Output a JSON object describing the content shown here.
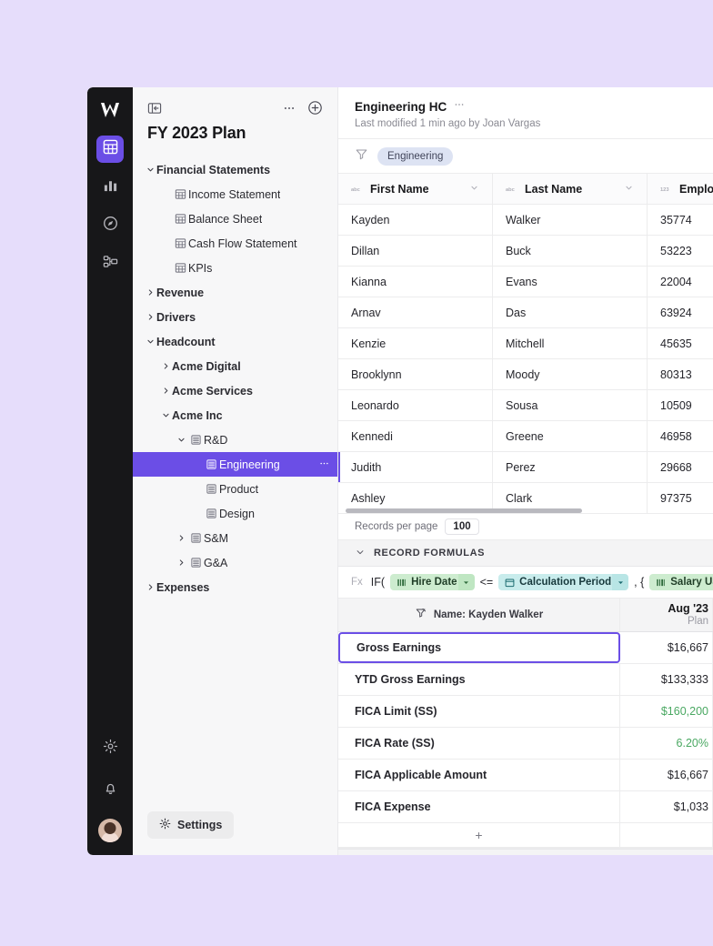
{
  "theme": {
    "canvas_bg": "#e6ddfb",
    "accent": "#6b4ee6",
    "rail_bg": "#171719",
    "sidebar_bg": "#f7f7f8",
    "pill_bg": "#dde3f3",
    "token_green": "#cdeccf",
    "token_blue": "#c8ecec",
    "value_green": "#4aa862"
  },
  "rail": {
    "logo_name": "workspace-logo",
    "items": [
      {
        "name": "grid-icon",
        "active": true
      },
      {
        "name": "chart-icon",
        "active": false
      },
      {
        "name": "compass-icon",
        "active": false
      },
      {
        "name": "model-map-icon",
        "active": false
      }
    ],
    "bottom": [
      {
        "name": "gear-icon"
      },
      {
        "name": "bell-icon"
      },
      {
        "name": "avatar"
      }
    ]
  },
  "sidebar": {
    "collapse_icon": "panel-collapse-icon",
    "more_icon": "ellipsis-icon",
    "add_icon": "plus-circle-icon",
    "title": "FY 2023 Plan",
    "settings_label": "Settings",
    "tree": [
      {
        "label": "Financial Statements",
        "depth": 0,
        "expanded": true,
        "bold": true,
        "icon": null
      },
      {
        "label": "Income Statement",
        "depth": 1,
        "expanded": null,
        "bold": false,
        "icon": "table-icon"
      },
      {
        "label": "Balance Sheet",
        "depth": 1,
        "expanded": null,
        "bold": false,
        "icon": "table-icon"
      },
      {
        "label": "Cash Flow Statement",
        "depth": 1,
        "expanded": null,
        "bold": false,
        "icon": "table-icon"
      },
      {
        "label": "KPIs",
        "depth": 1,
        "expanded": null,
        "bold": false,
        "icon": "table-icon"
      },
      {
        "label": "Revenue",
        "depth": 0,
        "expanded": false,
        "bold": true,
        "icon": null
      },
      {
        "label": "Drivers",
        "depth": 0,
        "expanded": false,
        "bold": true,
        "icon": null
      },
      {
        "label": "Headcount",
        "depth": 0,
        "expanded": true,
        "bold": true,
        "icon": null
      },
      {
        "label": "Acme Digital",
        "depth": 1,
        "expanded": false,
        "bold": true,
        "icon": null
      },
      {
        "label": "Acme Services",
        "depth": 1,
        "expanded": false,
        "bold": true,
        "icon": null
      },
      {
        "label": "Acme Inc",
        "depth": 1,
        "expanded": true,
        "bold": true,
        "icon": null
      },
      {
        "label": "R&D",
        "depth": 2,
        "expanded": true,
        "bold": false,
        "icon": "list-icon"
      },
      {
        "label": "Engineering",
        "depth": 3,
        "expanded": null,
        "bold": false,
        "icon": "list-icon",
        "selected": true,
        "trailing_icon": "ellipsis-icon"
      },
      {
        "label": "Product",
        "depth": 3,
        "expanded": null,
        "bold": false,
        "icon": "list-icon"
      },
      {
        "label": "Design",
        "depth": 3,
        "expanded": null,
        "bold": false,
        "icon": "list-icon"
      },
      {
        "label": "S&M",
        "depth": 2,
        "expanded": false,
        "bold": false,
        "icon": "list-icon"
      },
      {
        "label": "G&A",
        "depth": 2,
        "expanded": false,
        "bold": false,
        "icon": "list-icon"
      },
      {
        "label": "Expenses",
        "depth": 0,
        "expanded": false,
        "bold": true,
        "icon": null
      }
    ]
  },
  "document": {
    "title": "Engineering HC",
    "more_icon": "ellipsis-icon",
    "subtitle": "Last modified 1 min ago by Joan Vargas"
  },
  "filters": {
    "filter_icon": "filter-icon",
    "chips": [
      "Engineering"
    ]
  },
  "table": {
    "columns": [
      {
        "label": "First Name",
        "type_icon": "abc-icon",
        "caret": "chevron-down-icon"
      },
      {
        "label": "Last Name",
        "type_icon": "abc-icon",
        "caret": "chevron-down-icon"
      },
      {
        "label": "Employee ID",
        "type_icon": "123-icon",
        "caret": "chevron-down-icon"
      }
    ],
    "rows": [
      {
        "first": "Kayden",
        "last": "Walker",
        "id": "35774"
      },
      {
        "first": "Dillan",
        "last": "Buck",
        "id": "53223"
      },
      {
        "first": "Kianna",
        "last": "Evans",
        "id": "22004"
      },
      {
        "first": "Arnav",
        "last": "Das",
        "id": "63924"
      },
      {
        "first": "Kenzie",
        "last": "Mitchell",
        "id": "45635"
      },
      {
        "first": "Brooklynn",
        "last": "Moody",
        "id": "80313"
      },
      {
        "first": "Leonardo",
        "last": "Sousa",
        "id": "10509"
      },
      {
        "first": "Kennedi",
        "last": "Greene",
        "id": "46958"
      },
      {
        "first": "Judith",
        "last": "Perez",
        "id": "29668",
        "selected": true
      },
      {
        "first": "Ashley",
        "last": "Clark",
        "id": "97375"
      }
    ],
    "records_per_page_label": "Records per page",
    "records_per_page_value": "100"
  },
  "record_formulas": {
    "section_label": "RECORD FORMULAS",
    "collapse_icon": "chevron-down-icon",
    "formula": {
      "fx_label": "Fx",
      "parts": [
        {
          "kind": "text",
          "text": "IF("
        },
        {
          "kind": "token",
          "text": "Hire Date",
          "color": "green",
          "icon": "field-icon",
          "caret": true
        },
        {
          "kind": "text",
          "text": "<="
        },
        {
          "kind": "token",
          "text": "Calculation Period",
          "color": "blue",
          "icon": "calendar-icon",
          "caret": true
        },
        {
          "kind": "text",
          "text": ", {"
        },
        {
          "kind": "token",
          "text": "Salary US",
          "color": "green",
          "icon": "field-icon",
          "caret": false
        }
      ]
    },
    "context_icon": "filter-record-icon",
    "context_label": "Name: Kayden Walker",
    "value_column": {
      "name": "Aug '23",
      "sub": "Plan"
    },
    "rows": [
      {
        "label": "Gross Earnings",
        "value": "$16,667",
        "green": false,
        "selected": true
      },
      {
        "label": "YTD Gross Earnings",
        "value": "$133,333",
        "green": false,
        "selected": false
      },
      {
        "label": "FICA Limit (SS)",
        "value": "$160,200",
        "green": true,
        "selected": false
      },
      {
        "label": "FICA Rate (SS)",
        "value": "6.20%",
        "green": true,
        "selected": false
      },
      {
        "label": "FICA Applicable Amount",
        "value": "$16,667",
        "green": false,
        "selected": false
      },
      {
        "label": "FICA Expense",
        "value": "$1,033",
        "green": false,
        "selected": false
      }
    ],
    "add_row_label": "+"
  }
}
